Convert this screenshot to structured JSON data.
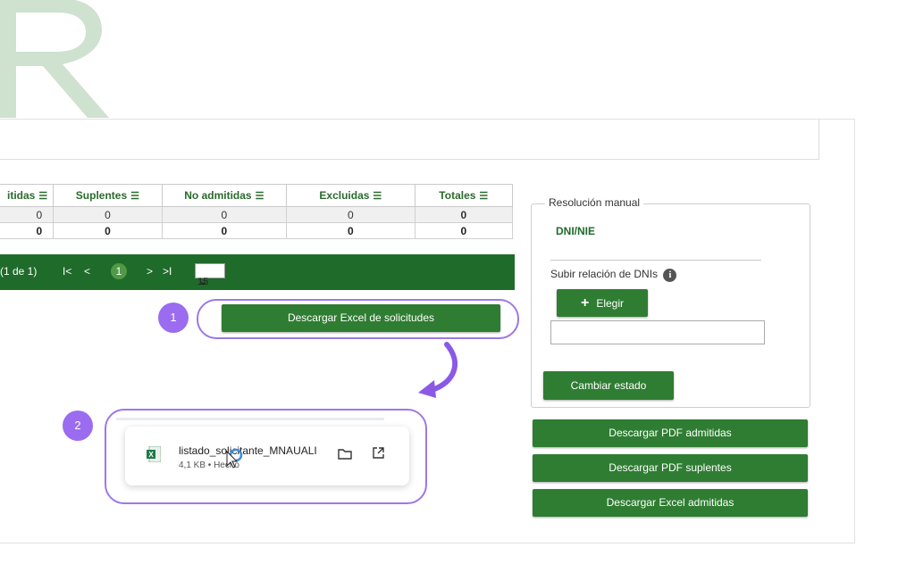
{
  "table": {
    "headers": [
      "itidas",
      "Suplentes",
      "No admitidas",
      "Excluidas",
      "Totales"
    ],
    "rows": [
      [
        "0",
        "0",
        "0",
        "0",
        "0"
      ],
      [
        "0",
        "0",
        "0",
        "0",
        "0"
      ]
    ]
  },
  "pager": {
    "info": "(1 de 1)",
    "first": "I<",
    "prev": "<",
    "current": "1",
    "next": ">",
    "last": ">I",
    "page_size": "15"
  },
  "actions": {
    "download_excel_requests": "Descargar Excel de solicitudes"
  },
  "steps": {
    "one": "1",
    "two": "2"
  },
  "download": {
    "filename": "listado_solicitante_MNAUALI",
    "meta": "4,1 KB • Hecho"
  },
  "manual": {
    "legend": "Resolución manual",
    "dni_label": "DNI/NIE",
    "upload_label": "Subir relación de DNIs",
    "choose_button": "Elegir",
    "file_value": "",
    "change_state_button": "Cambiar estado"
  },
  "downloads": {
    "pdf_admitted": "Descargar PDF admitidas",
    "pdf_substitutes": "Descargar PDF suplentes",
    "excel_admitted": "Descargar Excel admitidas"
  },
  "colors": {
    "green": "#2f7d32",
    "dark_green": "#1f6b2a",
    "purple": "#9d78e6",
    "logo": "#cfe1cf"
  }
}
